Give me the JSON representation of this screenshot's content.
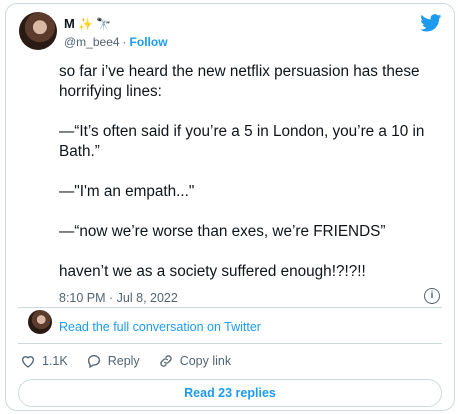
{
  "author": {
    "display_name": "M",
    "handle": "@m_bee4",
    "separator": "·",
    "follow_label": "Follow",
    "name_emojis": [
      "✨",
      "🔭"
    ]
  },
  "tweet": {
    "lines": [
      "so far i’ve heard the new netflix persuasion has these horrifying lines:",
      "—“It’s often said if you’re a 5 in London, you’re a 10 in Bath.”",
      "—\"I'm an empath...\"",
      "—“now we’re worse than exes, we’re FRIENDS”",
      "haven’t we as a society suffered enough!?!?!!"
    ],
    "timestamp": "8:10 PM · Jul 8, 2022"
  },
  "conversation": {
    "link_label": "Read the full conversation on Twitter"
  },
  "actions": {
    "likes": "1.1K",
    "reply_label": "Reply",
    "copy_label": "Copy link"
  },
  "replies": {
    "button_label": "Read 23 replies"
  },
  "colors": {
    "accent": "#1d9bf0",
    "text": "#0f1419",
    "muted": "#536471",
    "border": "#cfd9de"
  },
  "icons": [
    "twitter-bird-icon",
    "info-icon",
    "heart-icon",
    "reply-icon",
    "link-icon"
  ]
}
